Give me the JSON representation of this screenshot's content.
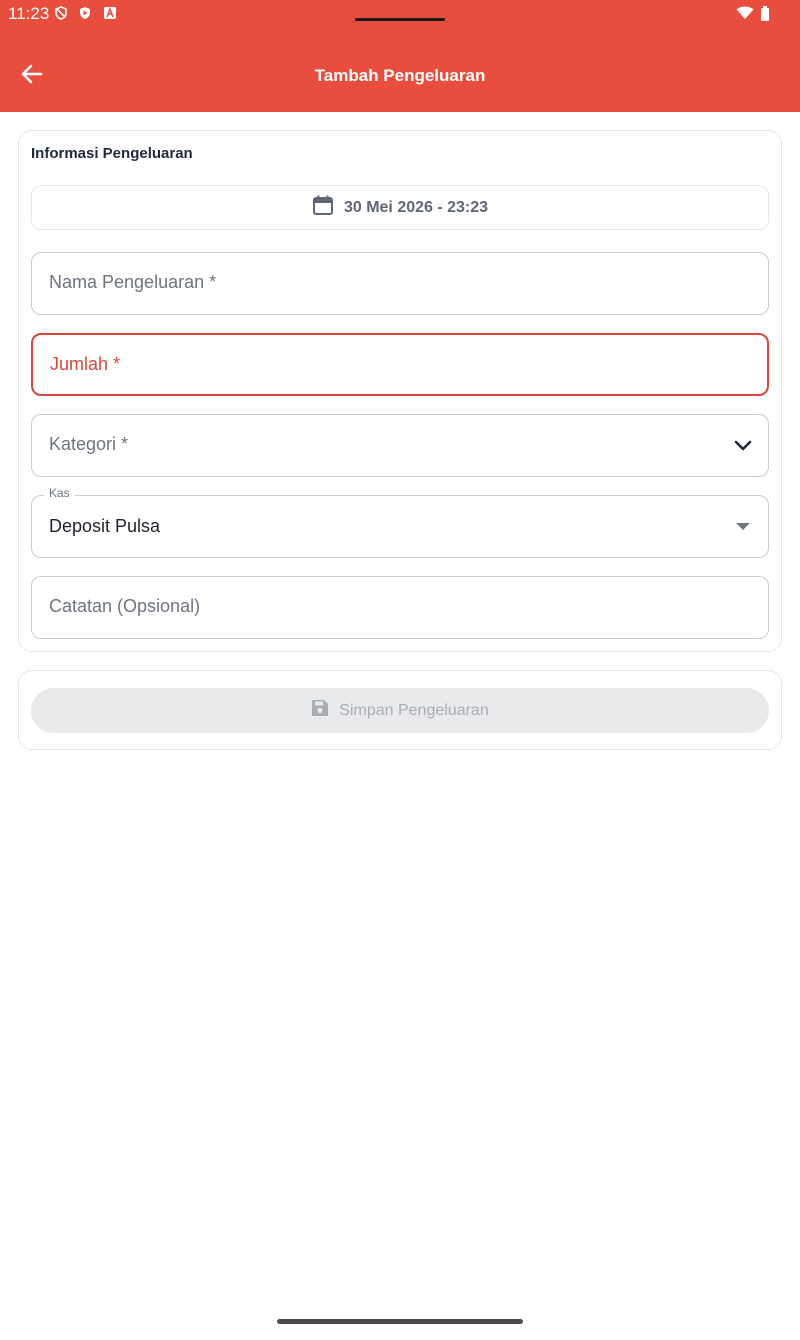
{
  "status_bar": {
    "time": "11:23",
    "icons": [
      "shield-off-icon",
      "shield-play-icon",
      "app-a-icon",
      "wifi-icon",
      "battery-icon"
    ]
  },
  "app_bar": {
    "title": "Tambah Pengeluaran",
    "back_icon": "arrow-left-icon",
    "background": "#E84D3D"
  },
  "form": {
    "section_title": "Informasi Pengeluaran",
    "date_button": {
      "icon": "calendar-icon",
      "label": "30 Mei 2026 - 23:23"
    },
    "fields": {
      "name": {
        "placeholder": "Nama Pengeluaran *"
      },
      "amount": {
        "placeholder": "Jumlah *",
        "state": "error",
        "error_color": "#D9453A"
      },
      "category": {
        "placeholder": "Kategori *",
        "icon": "chevron-down-icon"
      },
      "cash": {
        "label": "Kas",
        "value": "Deposit Pulsa",
        "icon": "dropdown-triangle-icon"
      },
      "note": {
        "placeholder": "Catatan (Opsional)"
      }
    }
  },
  "actions": {
    "save": {
      "label": "Simpan Pengeluaran",
      "icon": "save-icon",
      "enabled": false
    }
  }
}
